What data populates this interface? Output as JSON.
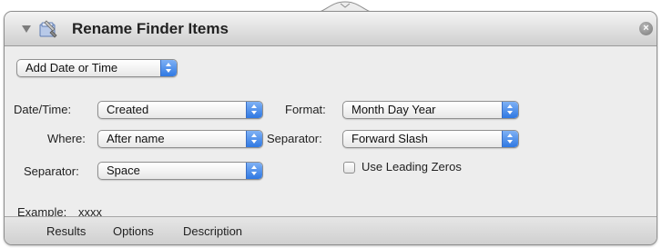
{
  "action": {
    "title": "Rename Finder Items",
    "icon": "finder-icon",
    "close_glyph": "×"
  },
  "mode_popup": {
    "value": "Add Date or Time"
  },
  "fields": {
    "date_time": {
      "label": "Date/Time:",
      "value": "Created"
    },
    "where": {
      "label": "Where:",
      "value": "After name"
    },
    "separator_left": {
      "label": "Separator:",
      "value": "Space"
    },
    "format": {
      "label": "Format:",
      "value": "Month Day Year"
    },
    "separator_right": {
      "label": "Separator:",
      "value": "Forward Slash"
    },
    "leading_zeros": {
      "label": "Use Leading Zeros",
      "checked": false
    }
  },
  "example": {
    "label": "Example:",
    "value": "xxxx"
  },
  "tabs": [
    {
      "label": "Results"
    },
    {
      "label": "Options"
    },
    {
      "label": "Description"
    }
  ],
  "colors": {
    "popup_arrow": "#2f78e3",
    "panel_bg": "#ededed"
  }
}
